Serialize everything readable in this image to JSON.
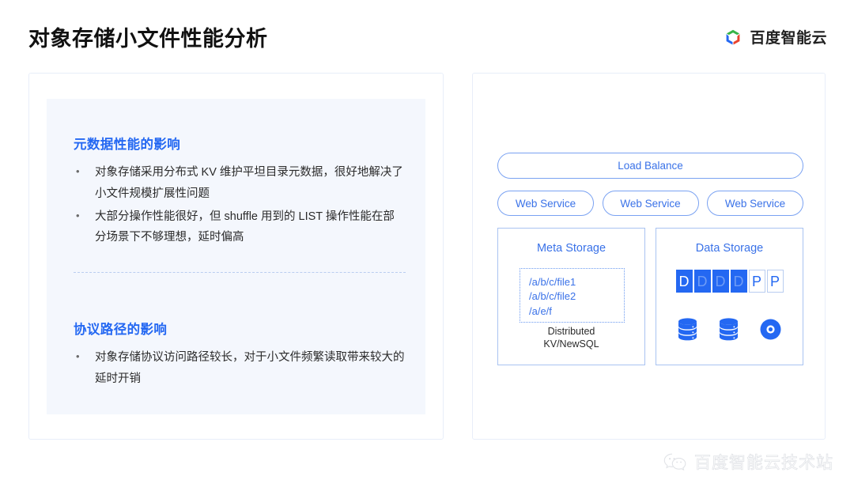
{
  "header": {
    "title": "对象存储小文件性能分析",
    "brand_name": "百度智能云",
    "brand_logo_icon": "baidu-cloud-cube-icon",
    "brand_colors": {
      "green": "#38b449",
      "red": "#e8432f",
      "blue": "#2468f2"
    }
  },
  "left_panel": {
    "sections": [
      {
        "title": "元数据性能的影响",
        "bullets": [
          "对象存储采用分布式 KV 维护平坦目录元数据，很好地解决了小文件规模扩展性问题",
          "大部分操作性能很好，但 shuffle 用到的 LIST 操作性能在部分场景下不够理想，延时偏高"
        ]
      },
      {
        "title": "协议路径的影响",
        "bullets": [
          "对象存储协议访问路径较长，对于小文件频繁读取带来较大的延时开销"
        ]
      }
    ],
    "accent_color": "#2468f2",
    "panel_background": "#f4f7fd"
  },
  "right_panel": {
    "load_balance": {
      "label": "Load Balance"
    },
    "web_services": [
      {
        "label": "Web Service"
      },
      {
        "label": "Web Service"
      },
      {
        "label": "Web Service"
      }
    ],
    "meta_storage": {
      "title": "Meta Storage",
      "paths": [
        "/a/b/c/file1",
        "/a/b/c/file2",
        "/a/e/f"
      ],
      "caption_line1": "Distributed",
      "caption_line2": "KV/NewSQL"
    },
    "data_storage": {
      "title": "Data Storage",
      "blocks": [
        {
          "label": "D",
          "style": "filled-solid"
        },
        {
          "label": "D",
          "style": "filled"
        },
        {
          "label": "D",
          "style": "filled"
        },
        {
          "label": "D",
          "style": "filled"
        },
        {
          "label": "P",
          "style": "outlined"
        },
        {
          "label": "P",
          "style": "outlined"
        }
      ],
      "icons": [
        "database-stack-icon",
        "database-stack-icon",
        "optical-disc-icon"
      ]
    },
    "outline_color": "#7aa2f2",
    "text_color": "#3a72e8"
  },
  "watermark": {
    "icon": "wechat-icon",
    "text": "百度智能云技术站"
  }
}
